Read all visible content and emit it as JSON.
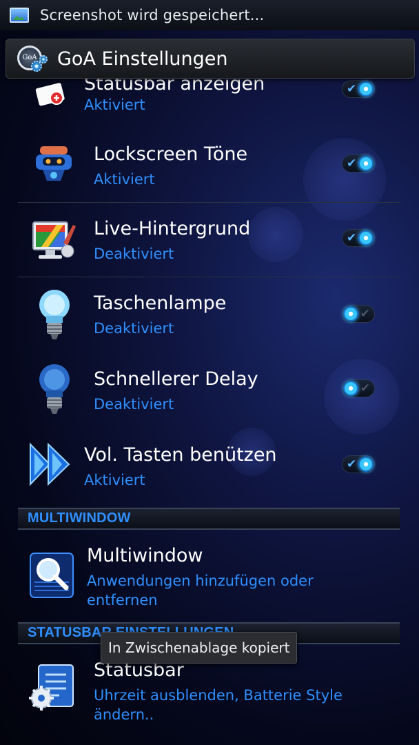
{
  "status_bar": {
    "notification_icon": "screenshot-icon",
    "text": "Screenshot wird gespeichert..."
  },
  "action_bar": {
    "app_icon": "goa-logo-icon",
    "logo_text": "GoA",
    "title": "GoA Einstellungen"
  },
  "settings": [
    {
      "title": "Statusbar anzeigen",
      "status": "Aktiviert",
      "icon": "statusbar-card-icon",
      "toggle": "on"
    },
    {
      "title": "Lockscreen Töne",
      "status": "Aktiviert",
      "icon": "robot-speaker-icon",
      "toggle": "on"
    },
    {
      "title": "Live-Hintergrund",
      "status": "Deaktiviert",
      "icon": "monitor-paint-icon",
      "toggle": "on"
    },
    {
      "title": "Taschenlampe",
      "status": "Deaktiviert",
      "icon": "lightbulb-icon",
      "toggle": "off"
    },
    {
      "title": "Schnellerer Delay",
      "status": "Deaktiviert",
      "icon": "lightbulb-blue-icon",
      "toggle": "off"
    },
    {
      "title": "Vol. Tasten benützen",
      "status": "Aktiviert",
      "icon": "fast-forward-icon",
      "toggle": "on"
    }
  ],
  "sections": {
    "multiwindow": {
      "header": "MULTIWINDOW",
      "item": {
        "title": "Multiwindow",
        "subtitle": "Anwendungen hinzufügen oder entfernen",
        "icon": "magnifier-grid-icon"
      }
    },
    "statusbar": {
      "header": "STATUSBAR EINSTELLUNGEN",
      "item": {
        "title": "Statusbar",
        "subtitle": "Uhrzeit ausblenden, Batterie Style ändern..",
        "icon": "settings-document-icon"
      }
    }
  },
  "toast": {
    "text": "In Zwischenablage kopiert"
  },
  "colors": {
    "accent": "#2f8fff",
    "toggle_knob": "#38c6ff",
    "background": "#05081c"
  }
}
